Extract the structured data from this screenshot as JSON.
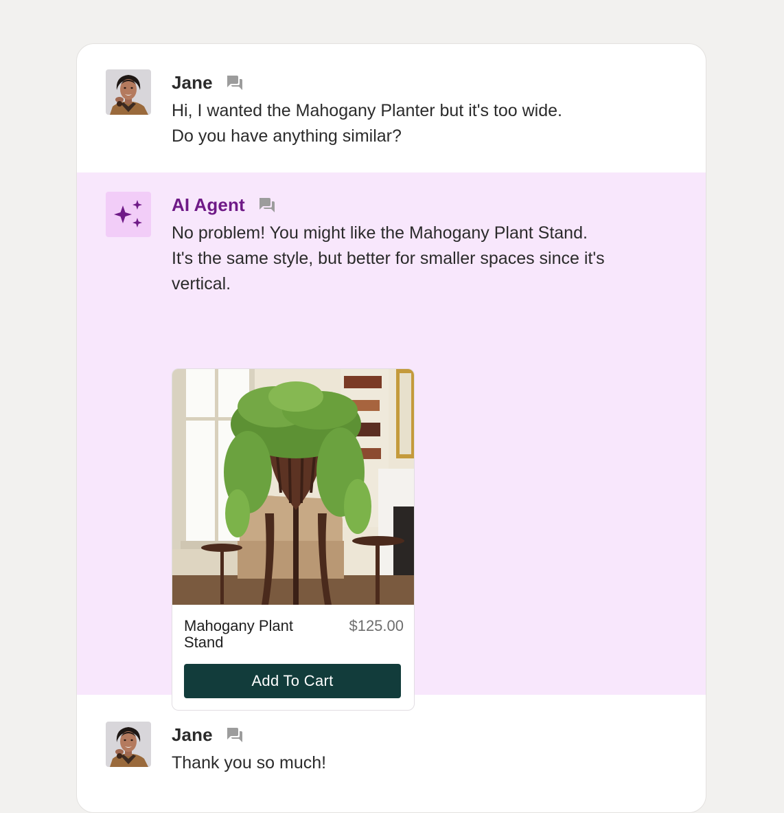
{
  "colors": {
    "page_background": "#f2f1ef",
    "panel_background": "#ffffff",
    "ai_row_background": "#f8e7fc",
    "ai_accent": "#6f1a87",
    "button_background": "#123c3b"
  },
  "messages": [
    {
      "sender": "Jane",
      "avatar": "customer-photo",
      "icon": "chat-bubbles-icon",
      "lines": [
        "Hi, I wanted the Mahogany Planter but it's too wide.",
        "Do you have anything similar?"
      ]
    },
    {
      "sender": "AI Agent",
      "avatar": "sparkle-icon",
      "icon": "chat-bubbles-icon",
      "lines": [
        "No problem! You might like the Mahogany Plant Stand.",
        "It's the same style, but better for smaller spaces since it's vertical."
      ],
      "product": {
        "name": "Mahogany Plant Stand",
        "price": "$125.00",
        "button_label": "Add To Cart",
        "image": "plant-stand-photo"
      }
    },
    {
      "sender": "Jane",
      "avatar": "customer-photo",
      "icon": "chat-bubbles-icon",
      "lines": [
        "Thank you so much!"
      ]
    }
  ]
}
